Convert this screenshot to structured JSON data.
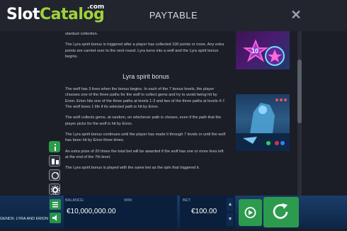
{
  "brand": {
    "logo_slot": "Slot",
    "logo_catalog": "Catalog",
    "logo_com": ".com"
  },
  "header": {
    "title": "PAYTABLE",
    "close_glyph": "✕"
  },
  "content": {
    "intro_text": "stardust collection.",
    "para1": "The Lyra spirit bonus is triggered after a player has collected 100 points or more. Any extra points are carried over to the next round. Lyra turns into a wolf and the Lyra spirit bonus begins.",
    "section_title": "Lyra spirit bonus",
    "para2": "The wolf has 3 lives when the bonus begins. In each of the 7 bonus levels, the player chooses one of the three paths for the wolf to collect gems and try to avoid being hit by Erion. Erion hits one of the three paths at levels 1-3 and two of the three paths at levels 4-7. The wolf loses 1 life if its selected path is hit by Erion.",
    "para3": "The wolf collects gems, at random, on whichever path is chosen, even if the path that the player picks for the wolf is hit by Erion.",
    "para4": "The Lyra spirit bonus continues until the player has made it through 7 levels or until the wolf has been hit by Erion three times.",
    "para5": "An extra prize of 20 times the total bet will be awarded if the wolf has one or more lives left at the end of the 7th level.",
    "para6": "The Lyra spirit bonus is played with the same bet as the spin that triggered it."
  },
  "illustrations": {
    "badge_number": "10"
  },
  "sidebar": {
    "icons": [
      "info-icon",
      "paytable-icon",
      "autoplay-icon",
      "settings-icon"
    ]
  },
  "bottom_bar": {
    "game_name_fragment": "GENDS: LYRA AND ERION",
    "balance_label": "BALANCE:",
    "balance_value": "€10,000,000.00",
    "win_label": "WIN:",
    "bet_label": "BET:",
    "bet_value": "€100.00",
    "arrow_up": "▲",
    "arrow_down": "▼"
  },
  "colors": {
    "accent_green": "#2d9b4e",
    "brand_green": "#9fd23a",
    "panel_blue": "#0a1f3c"
  }
}
